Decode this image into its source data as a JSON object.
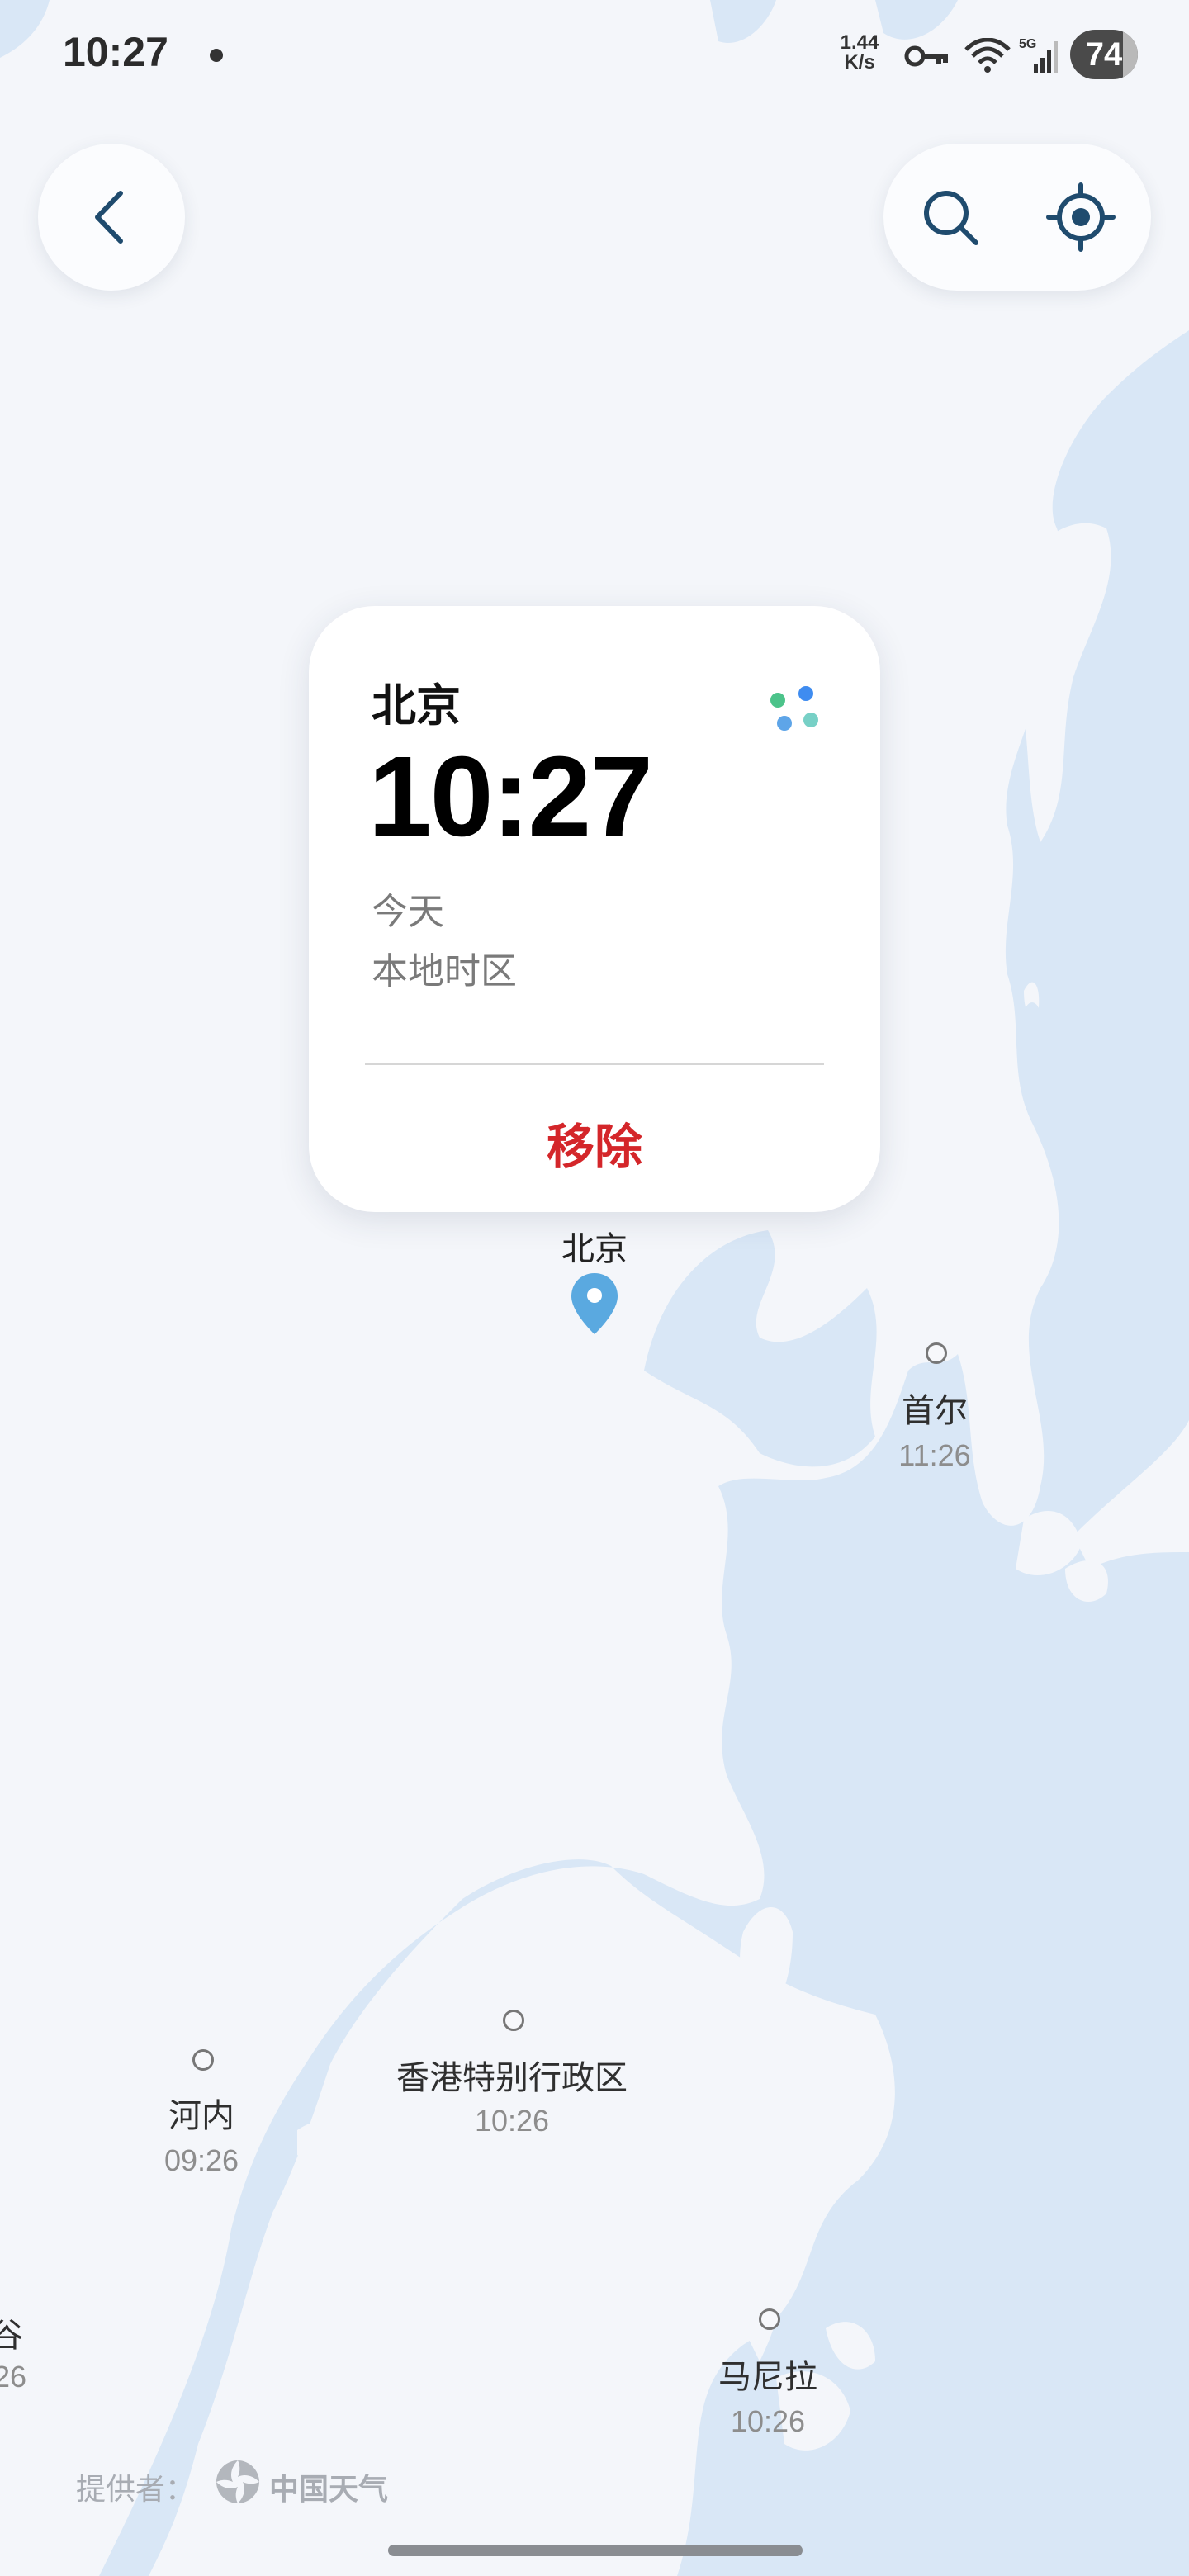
{
  "status_bar": {
    "time": "10:27",
    "net_speed_value": "1.44",
    "net_speed_unit": "K/s",
    "battery": "74",
    "icons": [
      "key-icon",
      "wifi-icon",
      "signal-5g-icon",
      "battery-icon"
    ]
  },
  "top_bar": {
    "back_icon": "chevron-left-icon",
    "search_icon": "search-icon",
    "locate_icon": "locate-icon"
  },
  "card": {
    "city": "北京",
    "time": "10:27",
    "day": "今天",
    "timezone_label": "本地时区",
    "remove_label": "移除",
    "colors": {
      "remove": "#d4262a"
    }
  },
  "map": {
    "pin_label": "北京",
    "cities": [
      {
        "name": "首尔",
        "time": "11:26"
      },
      {
        "name": "香港特别行政区",
        "time": "10:26"
      },
      {
        "name": "河内",
        "time": "09:26"
      },
      {
        "name": "马尼拉",
        "time": "10:26"
      },
      {
        "name": "谷",
        "time": "26"
      }
    ],
    "colors": {
      "land": "#f4f6fa",
      "water": "#d9e7f6",
      "pin": "#5aa9e0"
    }
  },
  "footer": {
    "provider_label": "提供者：",
    "provider_name": "中国天气"
  }
}
